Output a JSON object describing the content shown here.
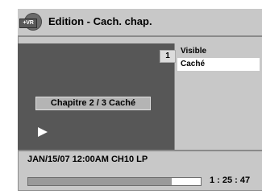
{
  "header": {
    "icon": "dvd-vr-disc-icon",
    "disc_badge": "+VR",
    "title": "Edition - Cach. chap."
  },
  "preview": {
    "chapter_number": "1",
    "chapter_label": "Chapitre  2 / 3  Caché",
    "play_icon": "play-icon"
  },
  "menu": {
    "items": [
      {
        "label": "Visible",
        "selected": false
      },
      {
        "label": "Caché",
        "selected": true
      }
    ]
  },
  "info": {
    "recording_line": "JAN/15/07 12:00AM CH10  LP",
    "elapsed_time": "1 : 25 : 47",
    "progress": 0.83
  },
  "colors": {
    "panel": "#c8c8c8",
    "preview_bg": "#575757",
    "selected_bg": "#ffffff"
  }
}
